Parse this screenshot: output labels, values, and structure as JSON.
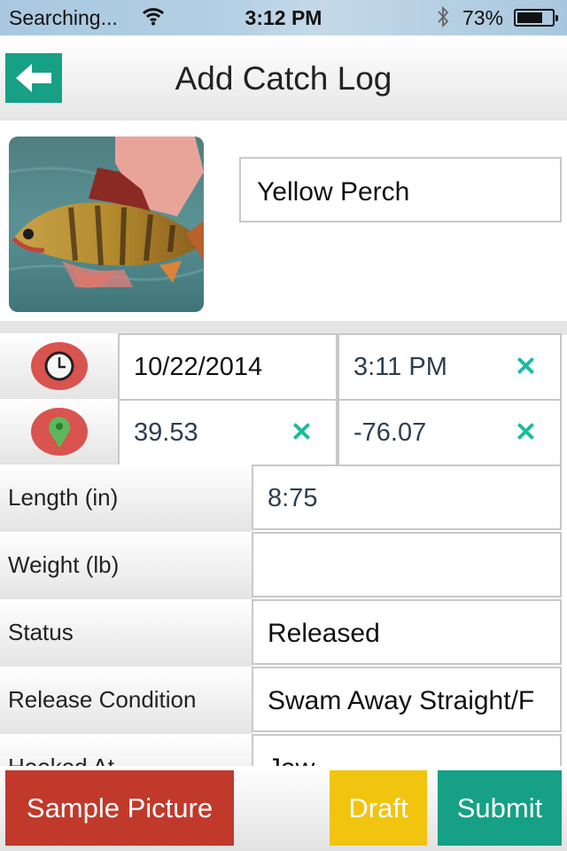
{
  "status_bar": {
    "carrier": "Searching...",
    "time": "3:12 PM",
    "battery_percent": "73%",
    "icons": [
      "wifi-icon",
      "bluetooth-icon",
      "battery-icon"
    ]
  },
  "header": {
    "title": "Add Catch Log",
    "back_icon": "arrow-left-icon"
  },
  "catch": {
    "photo": "yellow-perch-photo",
    "species": "Yellow Perch"
  },
  "datetime": {
    "icon": "clock-icon",
    "date": "10/22/2014",
    "time": "3:11 PM",
    "clear_icon": "✕"
  },
  "location": {
    "icon": "map-pin-icon",
    "latitude": "39.53",
    "longitude": "-76.07",
    "clear_icon": "✕"
  },
  "fields": [
    {
      "label": "Length (in)",
      "value": "8:75"
    },
    {
      "label": "Weight (lb)",
      "value": ""
    },
    {
      "label": "Status",
      "value": "Released"
    },
    {
      "label": "Release Condition",
      "value": "Swam Away Straight/F"
    },
    {
      "label": "Hooked At",
      "value": "Jaw"
    }
  ],
  "actions": {
    "sample_picture": "Sample Picture",
    "draft": "Draft",
    "submit": "Submit"
  },
  "colors": {
    "teal": "#16a085",
    "red": "#c0392b",
    "yellow": "#f1c40f",
    "clear_x": "#1abc9c"
  }
}
